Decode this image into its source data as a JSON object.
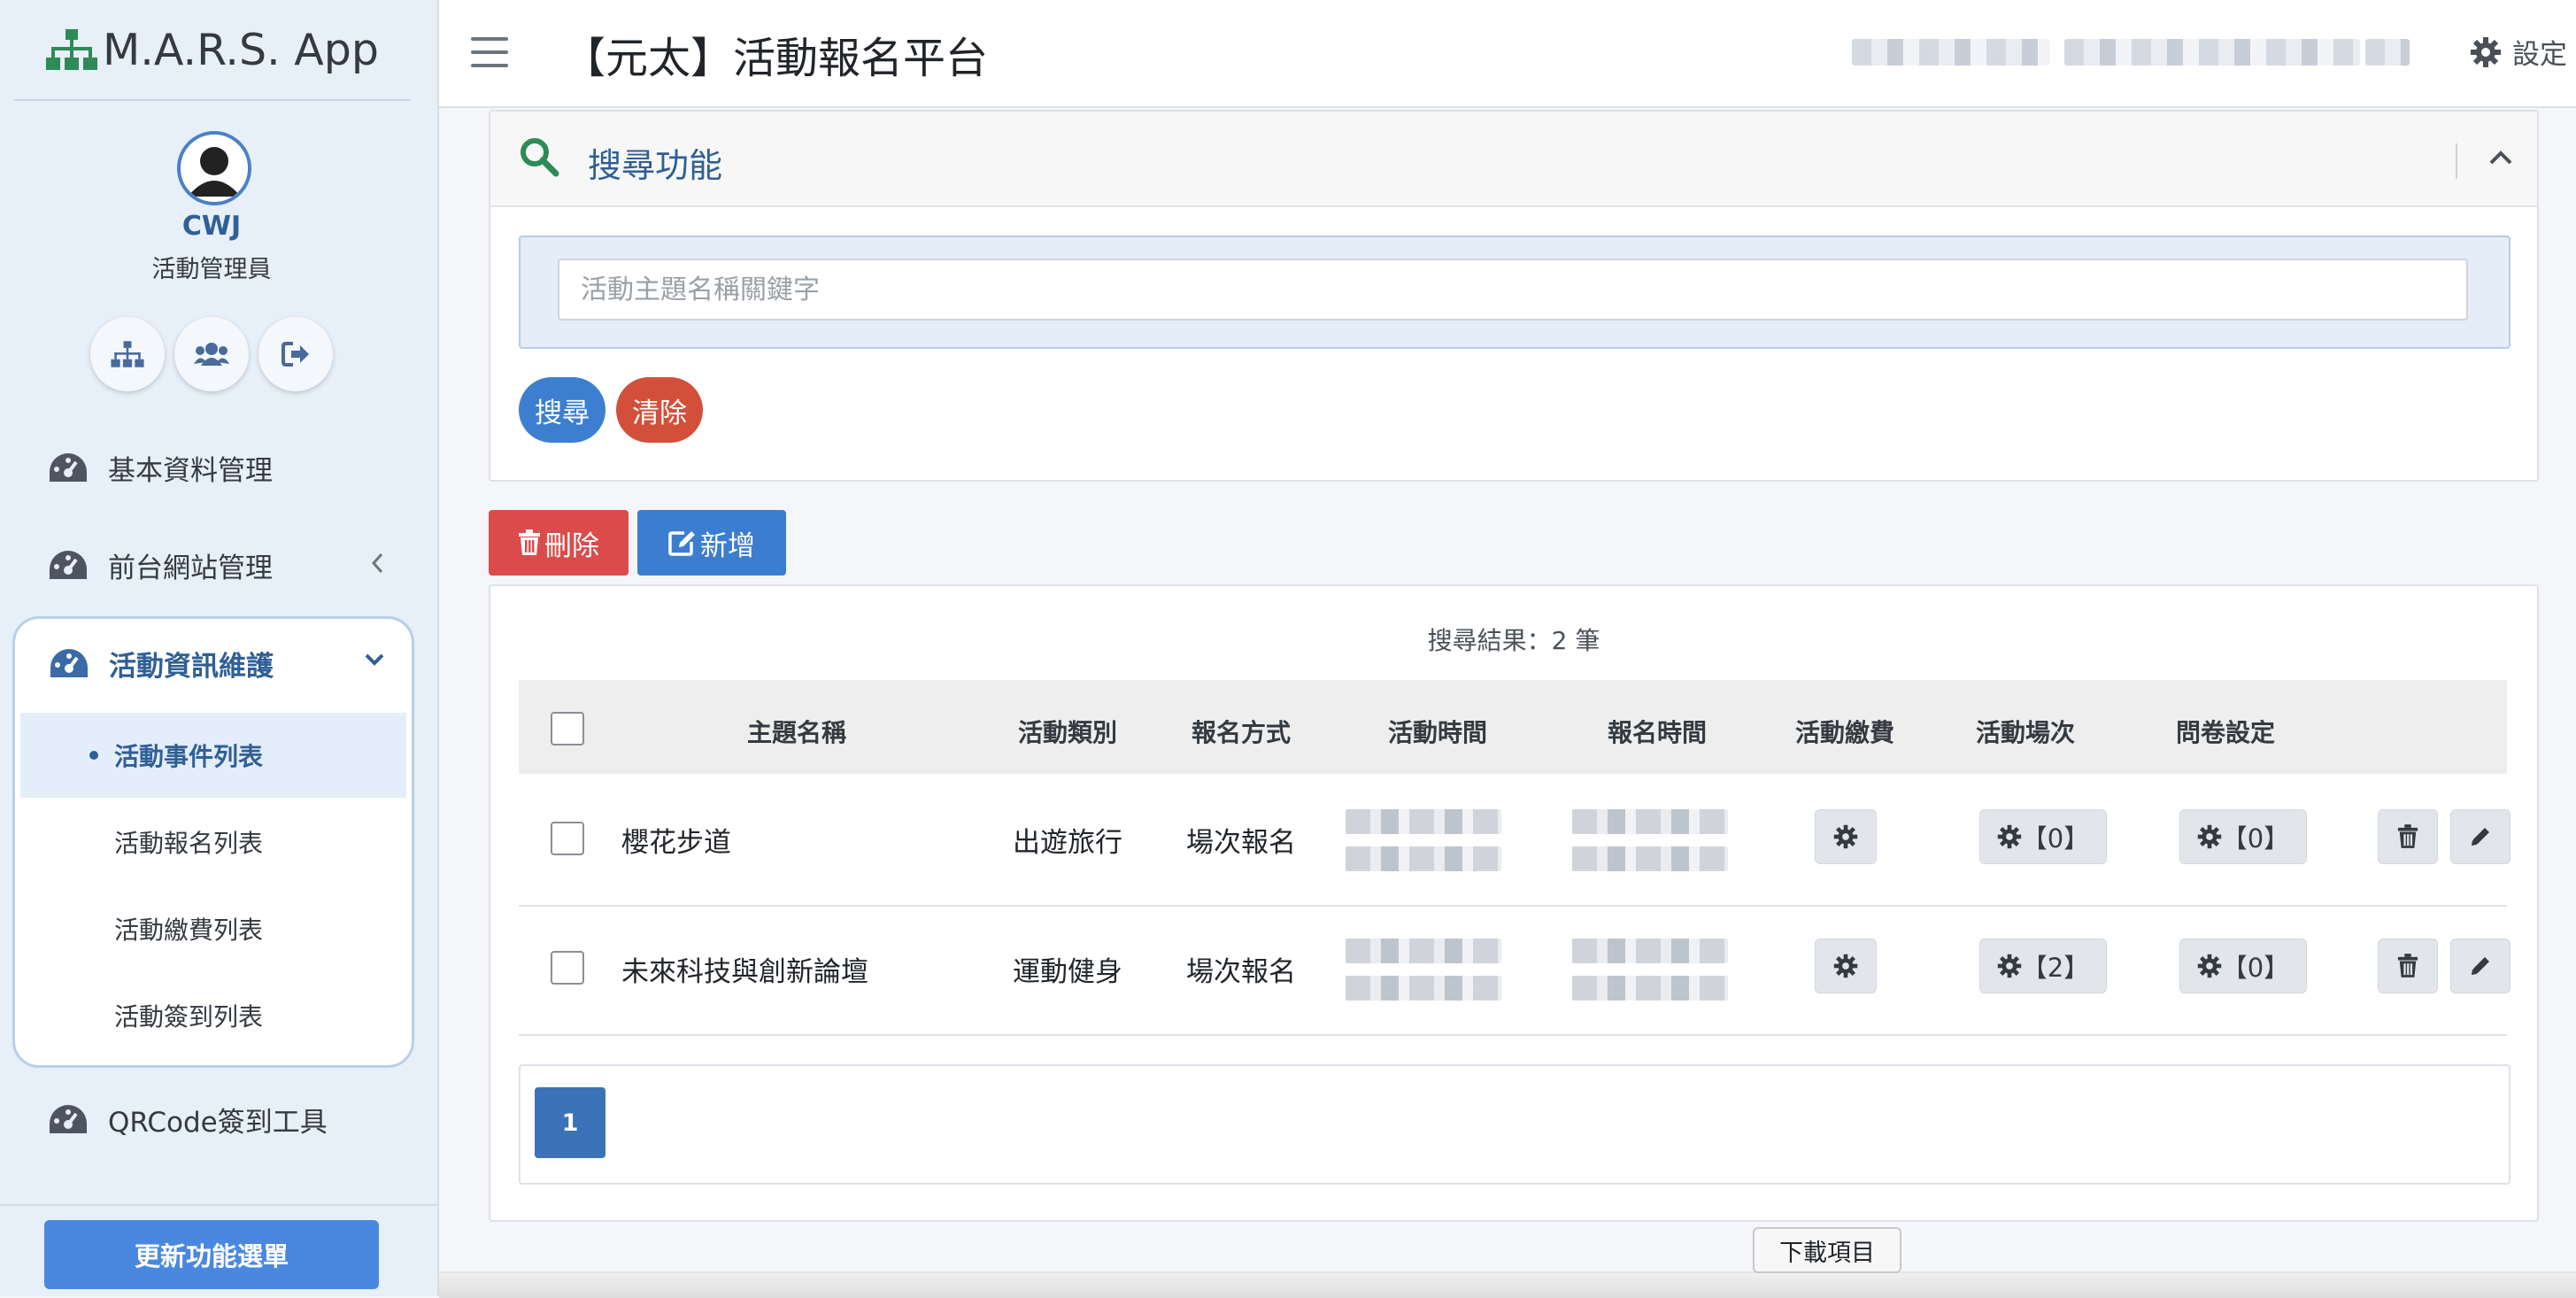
{
  "brand": {
    "name": "M.A.R.S. App"
  },
  "profile": {
    "name": "CWJ",
    "role": "活動管理員"
  },
  "sidebar": {
    "items": [
      {
        "label": "基本資料管理"
      },
      {
        "label": "前台網站管理"
      },
      {
        "label": "活動資訊維護"
      },
      {
        "label": "QRCode簽到工具"
      }
    ],
    "subitems": [
      {
        "label": "活動事件列表"
      },
      {
        "label": "活動報名列表"
      },
      {
        "label": "活動繳費列表"
      },
      {
        "label": "活動簽到列表"
      }
    ],
    "update_button": "更新功能選單"
  },
  "header": {
    "title": "【元太】活動報名平台",
    "settings_label": "設定"
  },
  "search": {
    "title": "搜尋功能",
    "placeholder": "活動主題名稱關鍵字",
    "search_button": "搜尋",
    "clear_button": "清除"
  },
  "actions": {
    "delete_label": "刪除",
    "add_label": "新增"
  },
  "table": {
    "result_text": "搜尋結果：2 筆",
    "columns": [
      "主題名稱",
      "活動類別",
      "報名方式",
      "活動時間",
      "報名時間",
      "活動繳費",
      "活動場次",
      "問卷設定"
    ],
    "rows": [
      {
        "name": "櫻花步道",
        "category": "出遊旅行",
        "method": "場次報名",
        "sessions": "【0】",
        "survey": "【0】"
      },
      {
        "name": "未來科技與創新論壇",
        "category": "運動健身",
        "method": "場次報名",
        "sessions": "【2】",
        "survey": "【0】"
      }
    ]
  },
  "pagination": {
    "current": "1"
  },
  "tooltip": {
    "text": "下載項目"
  },
  "colors": {
    "primary": "#4a88e0",
    "search_button": "#3d7fcf",
    "clear_button": "#d24f3a",
    "delete_button": "#dc4b4b",
    "add_button": "#3b7ed0",
    "accent_text": "#2f5f97"
  }
}
